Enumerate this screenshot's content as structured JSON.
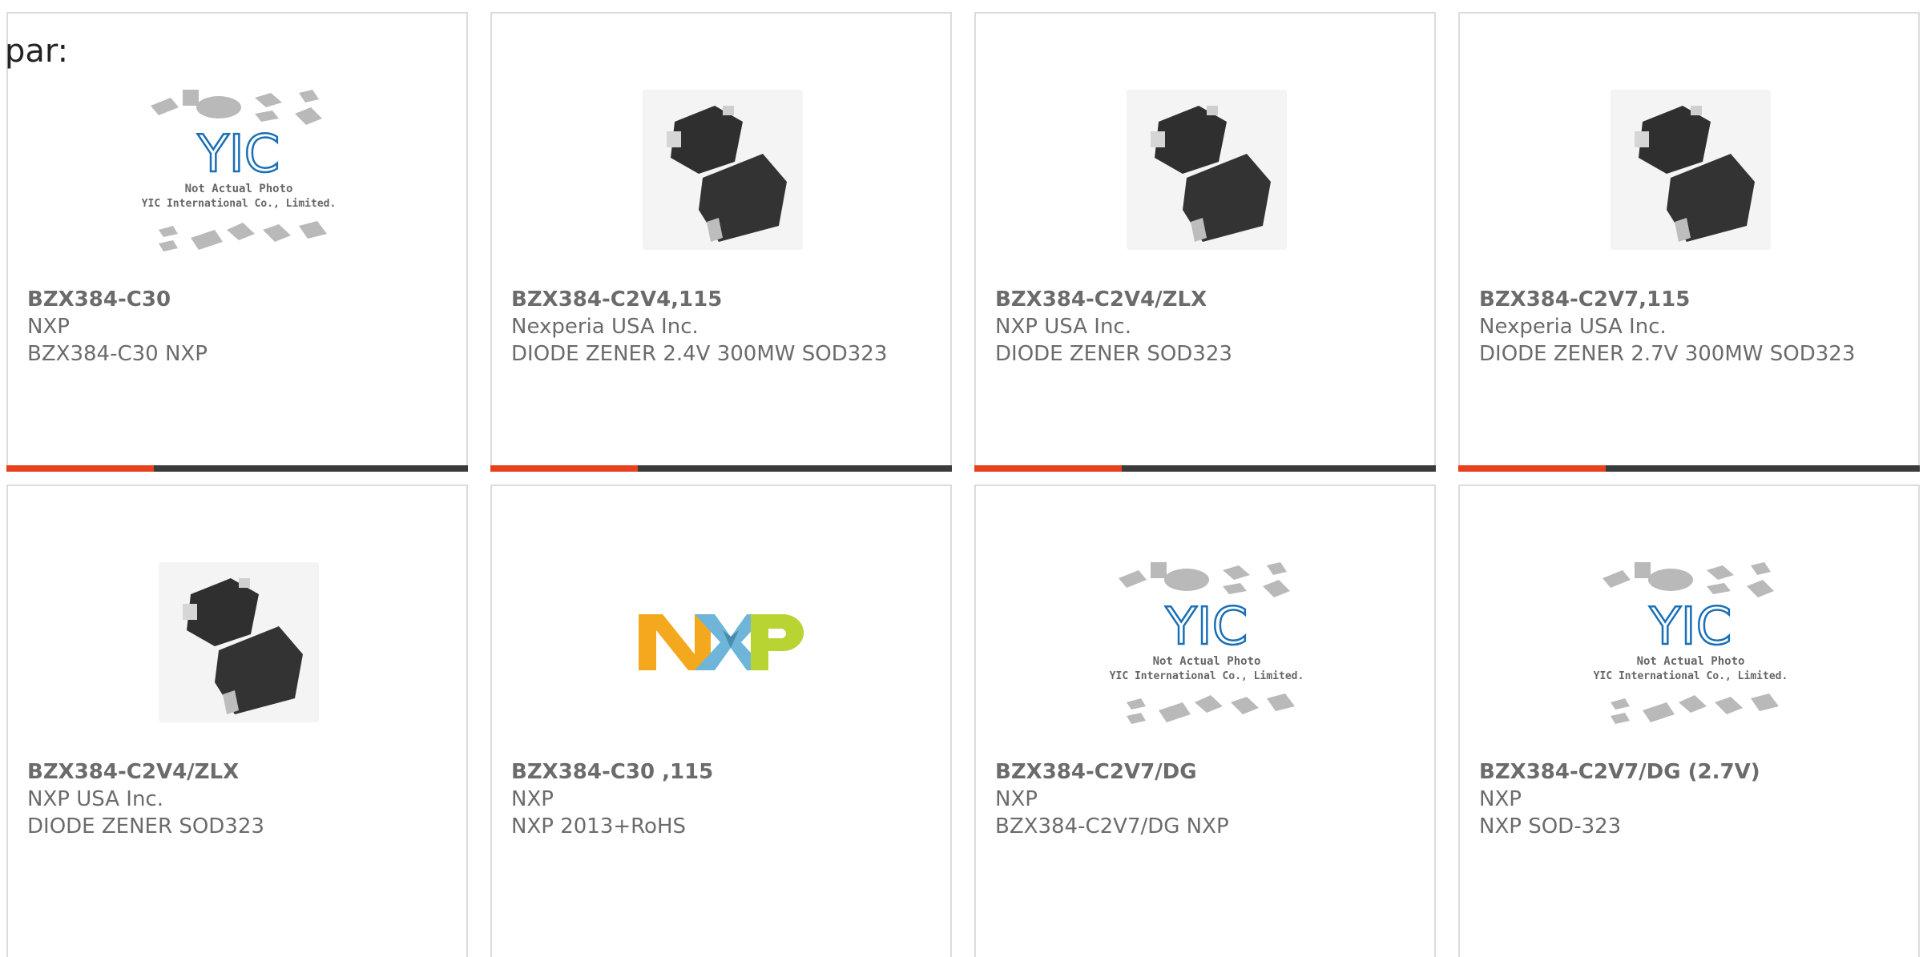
{
  "page": {
    "heading": "par:"
  },
  "products": [
    {
      "part_number": "BZX384-C30",
      "manufacturer": "NXP",
      "description": "BZX384-C30 NXP",
      "image_type": "yic-placeholder"
    },
    {
      "part_number": "BZX384-C2V4,115",
      "manufacturer": "Nexperia USA Inc.",
      "description": "DIODE ZENER 2.4V 300MW SOD323",
      "image_type": "sod323-package"
    },
    {
      "part_number": "BZX384-C2V4/ZLX",
      "manufacturer": "NXP USA Inc.",
      "description": "DIODE ZENER SOD323",
      "image_type": "sod323-package"
    },
    {
      "part_number": "BZX384-C2V7,115",
      "manufacturer": "Nexperia USA Inc.",
      "description": "DIODE ZENER 2.7V 300MW SOD323",
      "image_type": "sod323-package"
    },
    {
      "part_number": "BZX384-C2V4/ZLX",
      "manufacturer": "NXP USA Inc.",
      "description": "DIODE ZENER SOD323",
      "image_type": "sod323-package"
    },
    {
      "part_number": "BZX384-C30 ,115",
      "manufacturer": "NXP",
      "description": "NXP 2013+RoHS",
      "image_type": "nxp-logo"
    },
    {
      "part_number": "BZX384-C2V7/DG",
      "manufacturer": "NXP",
      "description": "BZX384-C2V7/DG NXP",
      "image_type": "yic-placeholder"
    },
    {
      "part_number": "BZX384-C2V7/DG (2.7V)",
      "manufacturer": "NXP",
      "description": "NXP SOD-323",
      "image_type": "yic-placeholder"
    }
  ],
  "placeholder": {
    "line1": "Not Actual Photo",
    "line2": "YIC International Co., Limited.",
    "brand": "YIC"
  },
  "nxp_logo_text": "NXP",
  "colors": {
    "card_border": "#dcdcdc",
    "bar_dark": "#3b3b3b",
    "bar_accent": "#e8401c",
    "text_gray": "#6b6b6b",
    "yic_blue": "#1a6fb5",
    "nxp_orange": "#f4a81d",
    "nxp_blue": "#6fb5d9",
    "nxp_green": "#b8d432"
  }
}
